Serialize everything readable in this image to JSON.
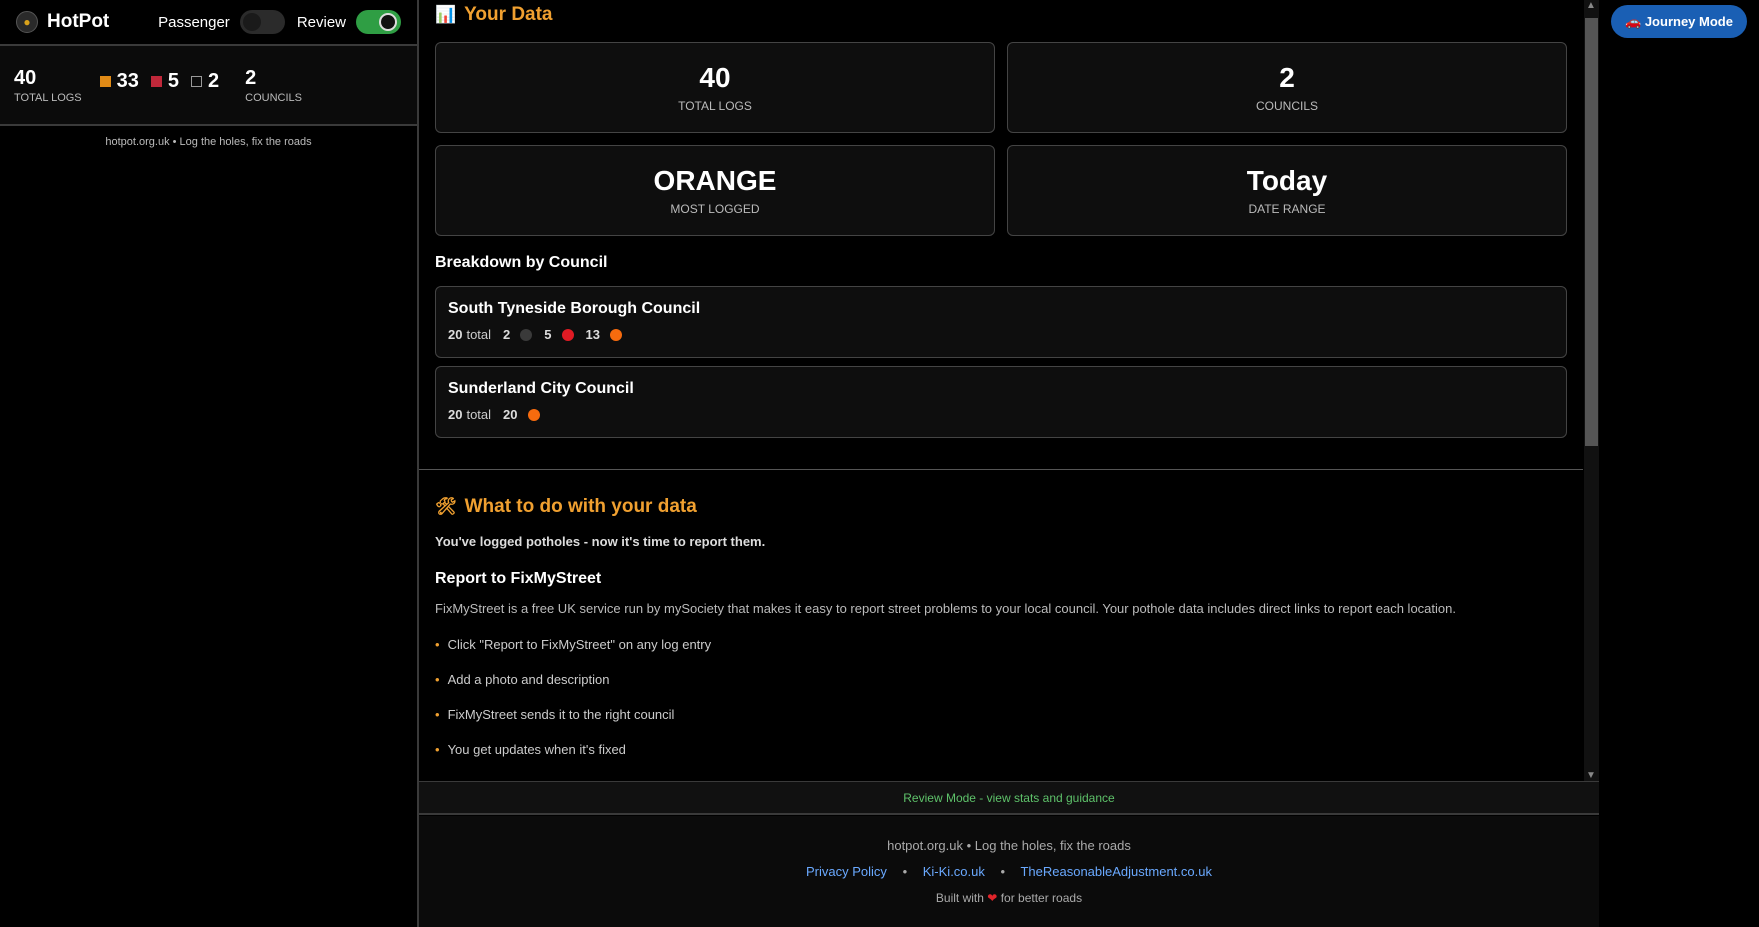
{
  "app": {
    "title": "HotPot",
    "logo_icon": "pot-icon"
  },
  "toggles": [
    {
      "label": "Passenger",
      "on": false
    },
    {
      "label": "Review",
      "on": true
    }
  ],
  "sidebar_stats": {
    "total": {
      "value": "40",
      "label": "TOTAL LOGS"
    },
    "chips": [
      {
        "color": "#e08a16",
        "count": "33"
      },
      {
        "color": "#c0283a",
        "count": "5"
      },
      {
        "color": "#555555",
        "count": "2"
      }
    ],
    "councils": {
      "value": "2",
      "label": "COUNCILS"
    },
    "footer": "hotpot.org.uk • Log the holes, fix the roads"
  },
  "your_data": {
    "icon": "chart-icon",
    "title": "Your Data",
    "cards": [
      {
        "value": "40",
        "label": "TOTAL LOGS"
      },
      {
        "value": "2",
        "label": "COUNCILS"
      },
      {
        "value": "ORANGE",
        "label": "MOST LOGGED"
      },
      {
        "value": "Today",
        "label": "DATE RANGE"
      }
    ]
  },
  "breakdown": {
    "title": "Breakdown by Council",
    "councils": [
      {
        "name": "South Tyneside Borough Council",
        "total": "20",
        "total_label": "total",
        "items": [
          {
            "count": "2",
            "color": "#3a3a3a"
          },
          {
            "count": "5",
            "color": "#e01b24"
          },
          {
            "count": "13",
            "color": "#f66b0e"
          }
        ]
      },
      {
        "name": "Sunderland City Council",
        "total": "20",
        "total_label": "total",
        "items": [
          {
            "count": "20",
            "color": "#f66b0e"
          }
        ]
      }
    ]
  },
  "guidance": {
    "icon": "tools-icon",
    "title": "What to do with your data",
    "intro": "You've logged potholes - now it's time to report them.",
    "report_title": "Report to FixMyStreet",
    "report_desc": "FixMyStreet is a free UK service run by mySociety that makes it easy to report street problems to your local council. Your pothole data includes direct links to report each location.",
    "steps": [
      "Click \"Report to FixMyStreet\" on any log entry",
      "Add a photo and description",
      "FixMyStreet sends it to the right council",
      "You get updates when it's fixed"
    ]
  },
  "status": "Review Mode - view stats and guidance",
  "footer": {
    "tagline": "hotpot.org.uk • Log the holes, fix the roads",
    "links": [
      "Privacy Policy",
      "Ki-Ki.co.uk",
      "TheReasonableAdjustment.co.uk"
    ],
    "built_prefix": "Built with",
    "built_suffix": "for better roads"
  },
  "journey_button": "🚗 Journey Mode"
}
